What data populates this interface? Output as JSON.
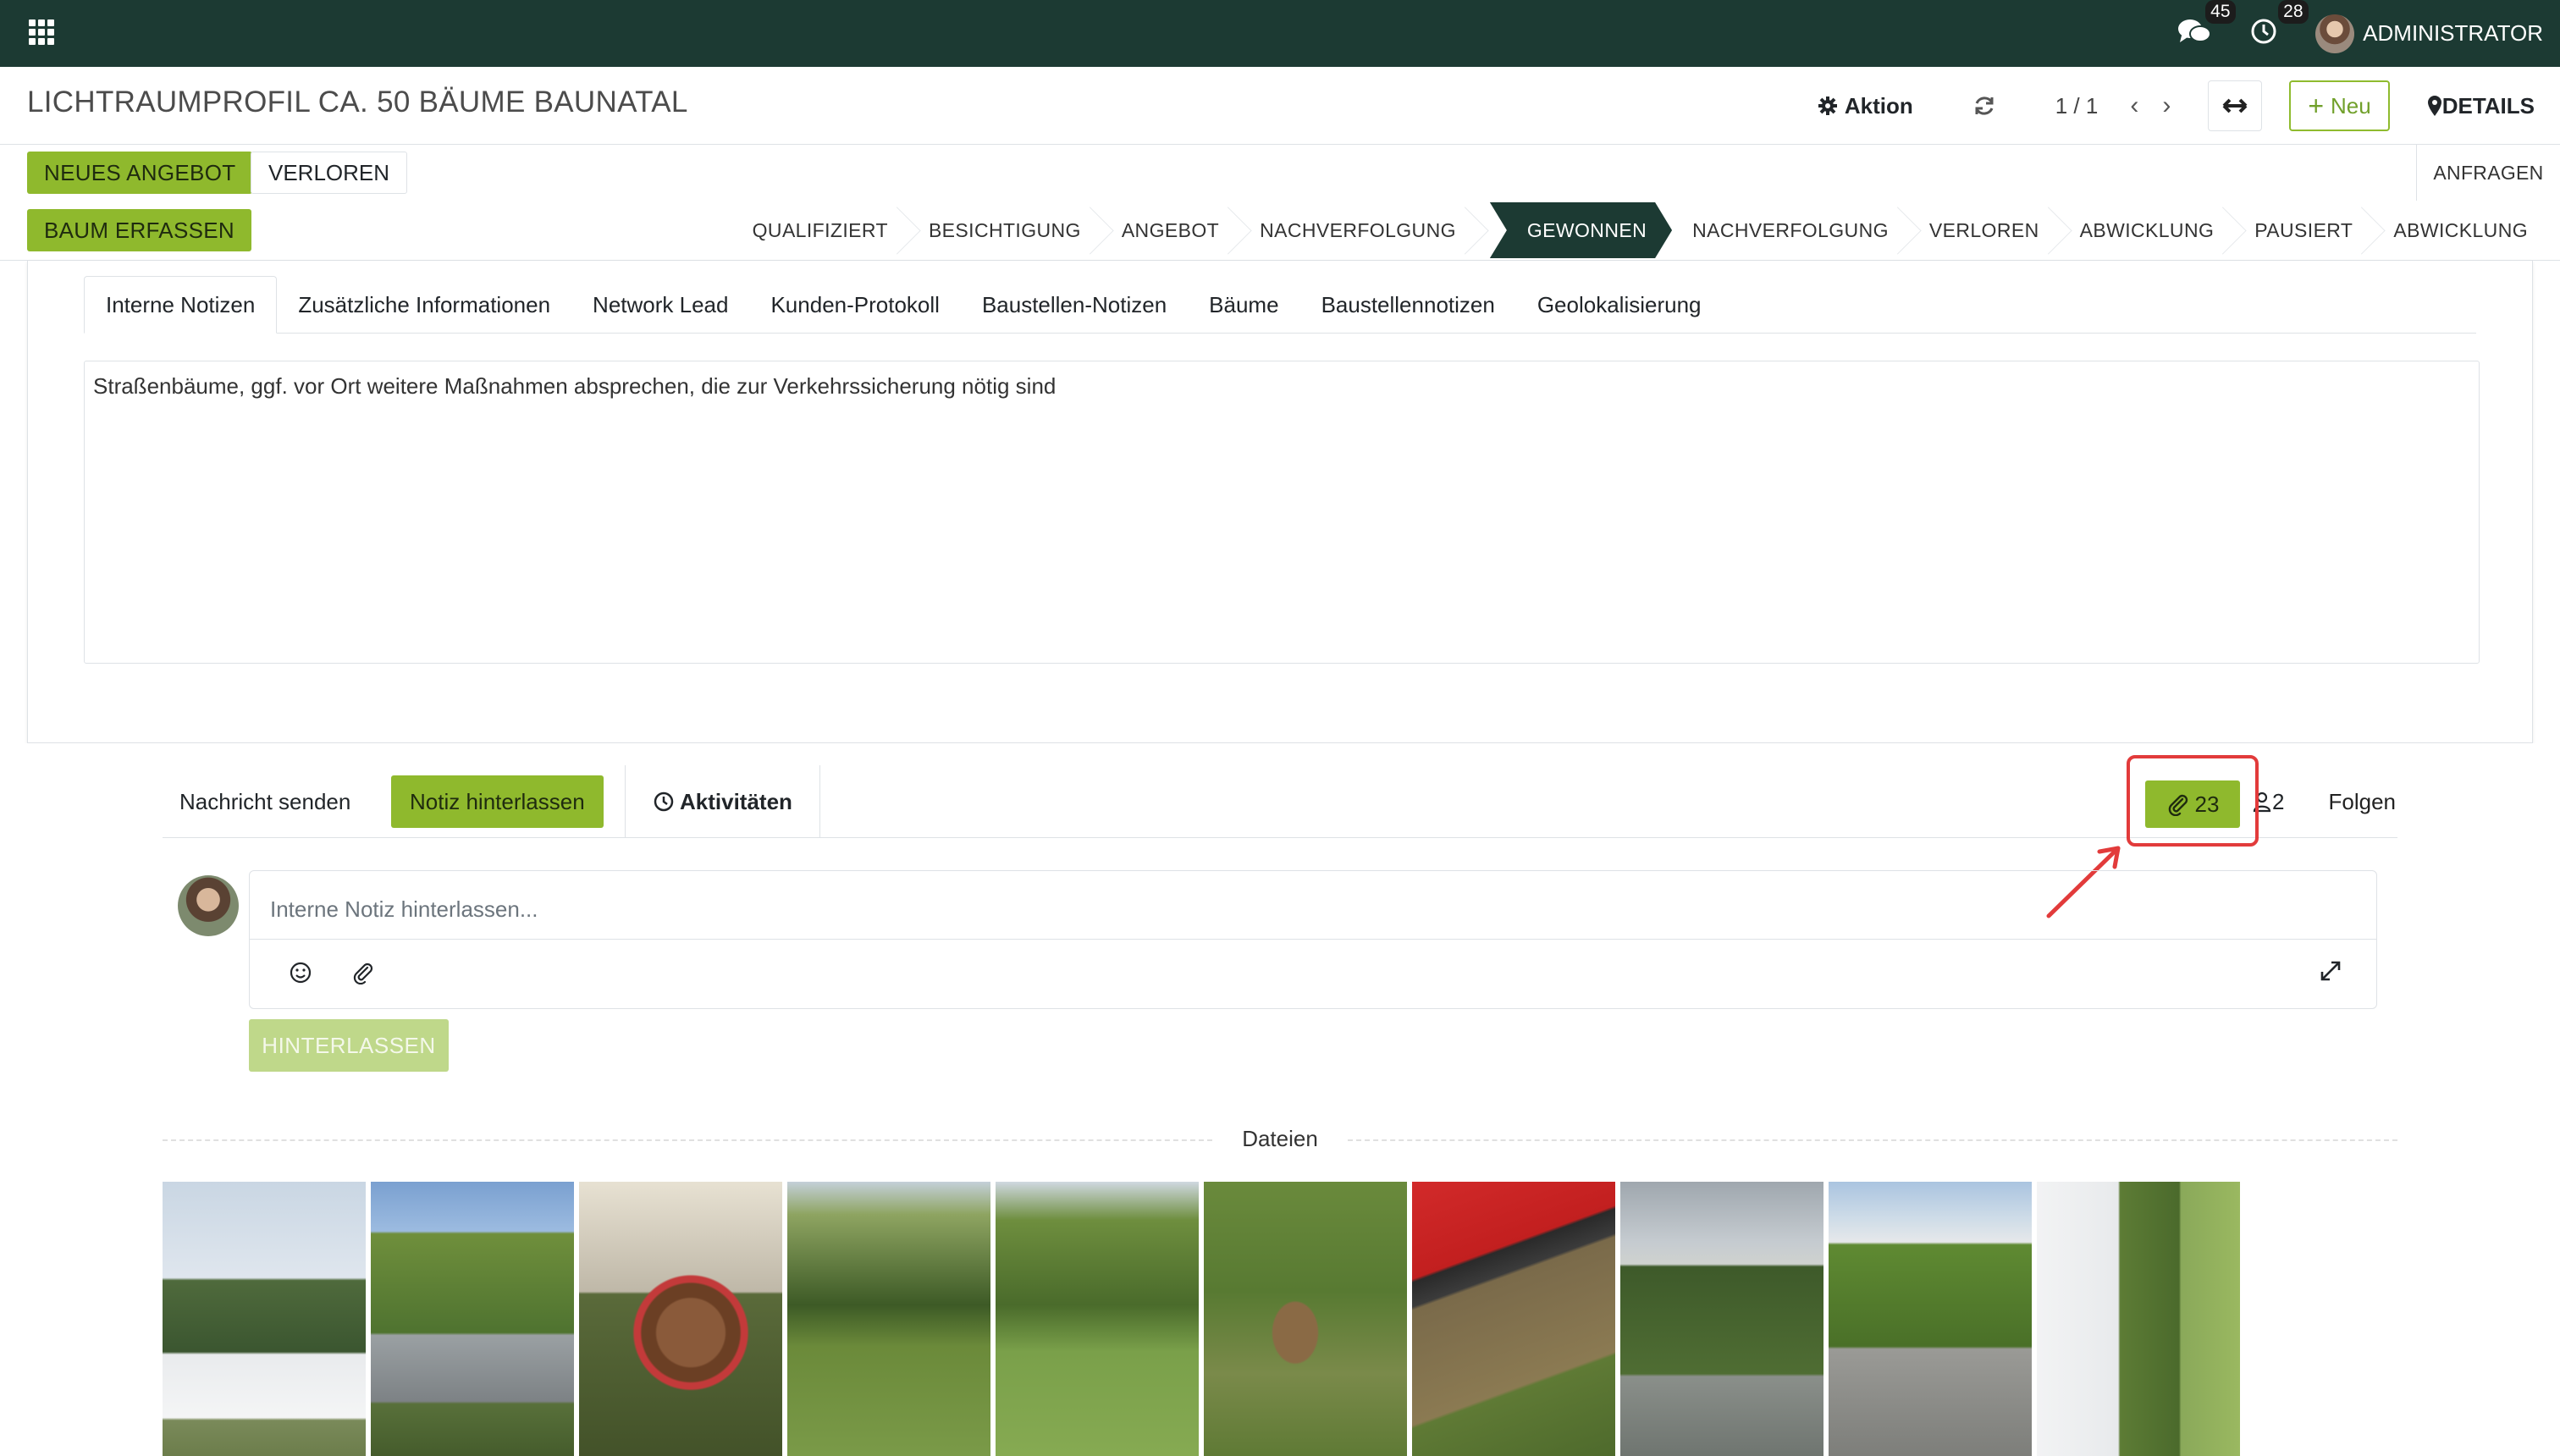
{
  "navbar": {
    "apps_icon": "apps-grid-icon",
    "messages_badge": "45",
    "activities_badge": "28",
    "user_name": "ADMINISTRATOR"
  },
  "control": {
    "breadcrumb": "LICHTRAUMPROFIL CA. 50 BÄUME BAUNATAL",
    "action_label": "Aktion",
    "pager": "1 / 1",
    "new_label": "Neu",
    "details_label": "DETAILS"
  },
  "statusbar": {
    "btn_new_offer": "NEUES ANGEBOT",
    "btn_lost": "VERLOREN",
    "btn_tree": "BAUM ERFASSEN",
    "anfragen": "ANFRAGEN",
    "stages": [
      "QUALIFIZIERT",
      "BESICHTIGUNG",
      "ANGEBOT",
      "NACHVERFOLGUNG",
      "GEWONNEN",
      "NACHVERFOLGUNG",
      "VERLOREN",
      "ABWICKLUNG",
      "PAUSIERT",
      "ABWICKLUNG"
    ],
    "active_stage": "GEWONNEN"
  },
  "tabs": [
    "Interne Notizen",
    "Zusätzliche Informationen",
    "Network Lead",
    "Kunden-Protokoll",
    "Baustellen-Notizen",
    "Bäume",
    "Baustellennotizen",
    "Geolokalisierung"
  ],
  "note_text": "Straßenbäume, ggf. vor Ort weitere Maßnahmen absprechen, die zur Verkehrssicherung nötig sind",
  "chatter": {
    "send_message": "Nachricht senden",
    "log_note": "Notiz hinterlassen",
    "activities": "Aktivitäten",
    "attachments_count": "23",
    "followers_count": "2",
    "follow": "Folgen",
    "composer_placeholder": "Interne Notiz hinterlassen...",
    "submit": "HINTERLASSEN",
    "files_label": "Dateien"
  },
  "colors": {
    "navbar": "#1c3a33",
    "primary_green": "#8fb92d",
    "highlight_red": "#e23b3b"
  }
}
